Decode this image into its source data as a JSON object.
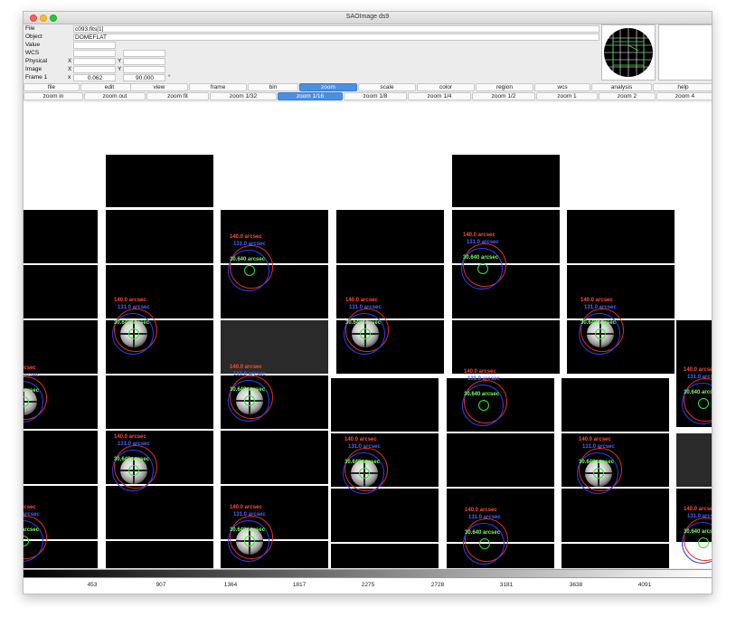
{
  "window": {
    "title": "SAOImage ds9"
  },
  "info": {
    "file_label": "File",
    "file_value": "c093.fits[1]",
    "object_label": "Object",
    "object_value": "DOMEFLAT",
    "value_label": "Value",
    "value_value": "",
    "wcs_label": "WCS",
    "wcs_value": "",
    "physical_label": "Physical",
    "physical_x_axis": "X",
    "physical_y_axis": "Y",
    "image_label": "Image",
    "image_x_axis": "X",
    "image_y_axis": "Y",
    "frame_label": "Frame 1",
    "frame_x_axis": "x",
    "zoom_value": "0.062",
    "angle_value": "90.000",
    "degree_symbol": "°"
  },
  "menu": [
    "file",
    "edit",
    "view",
    "frame",
    "bin",
    "zoom",
    "scale",
    "color",
    "region",
    "wcs",
    "analysis",
    "help"
  ],
  "menu_active": "zoom",
  "zoom_buttons": [
    "zoom in",
    "zoom out",
    "zoom fit",
    "zoom 1/32",
    "zoom 1/16",
    "zoom 1/8",
    "zoom 1/4",
    "zoom 1/2",
    "zoom 1",
    "zoom 2",
    "zoom 4"
  ],
  "zoom_active": "zoom 1/16",
  "regions": {
    "red_label": "140.0 arcsec",
    "blue_label": "131.0 arcsec",
    "green_label": "30.640 arcsec"
  },
  "colorbar_ticks": [
    "453",
    "907",
    "1364",
    "1817",
    "2275",
    "2728",
    "3181",
    "3638",
    "4091"
  ],
  "colors": {
    "accent": "#4a90e2",
    "region_red": "#e0301f",
    "region_blue": "#2f3fe6",
    "region_green": "#33e433"
  }
}
